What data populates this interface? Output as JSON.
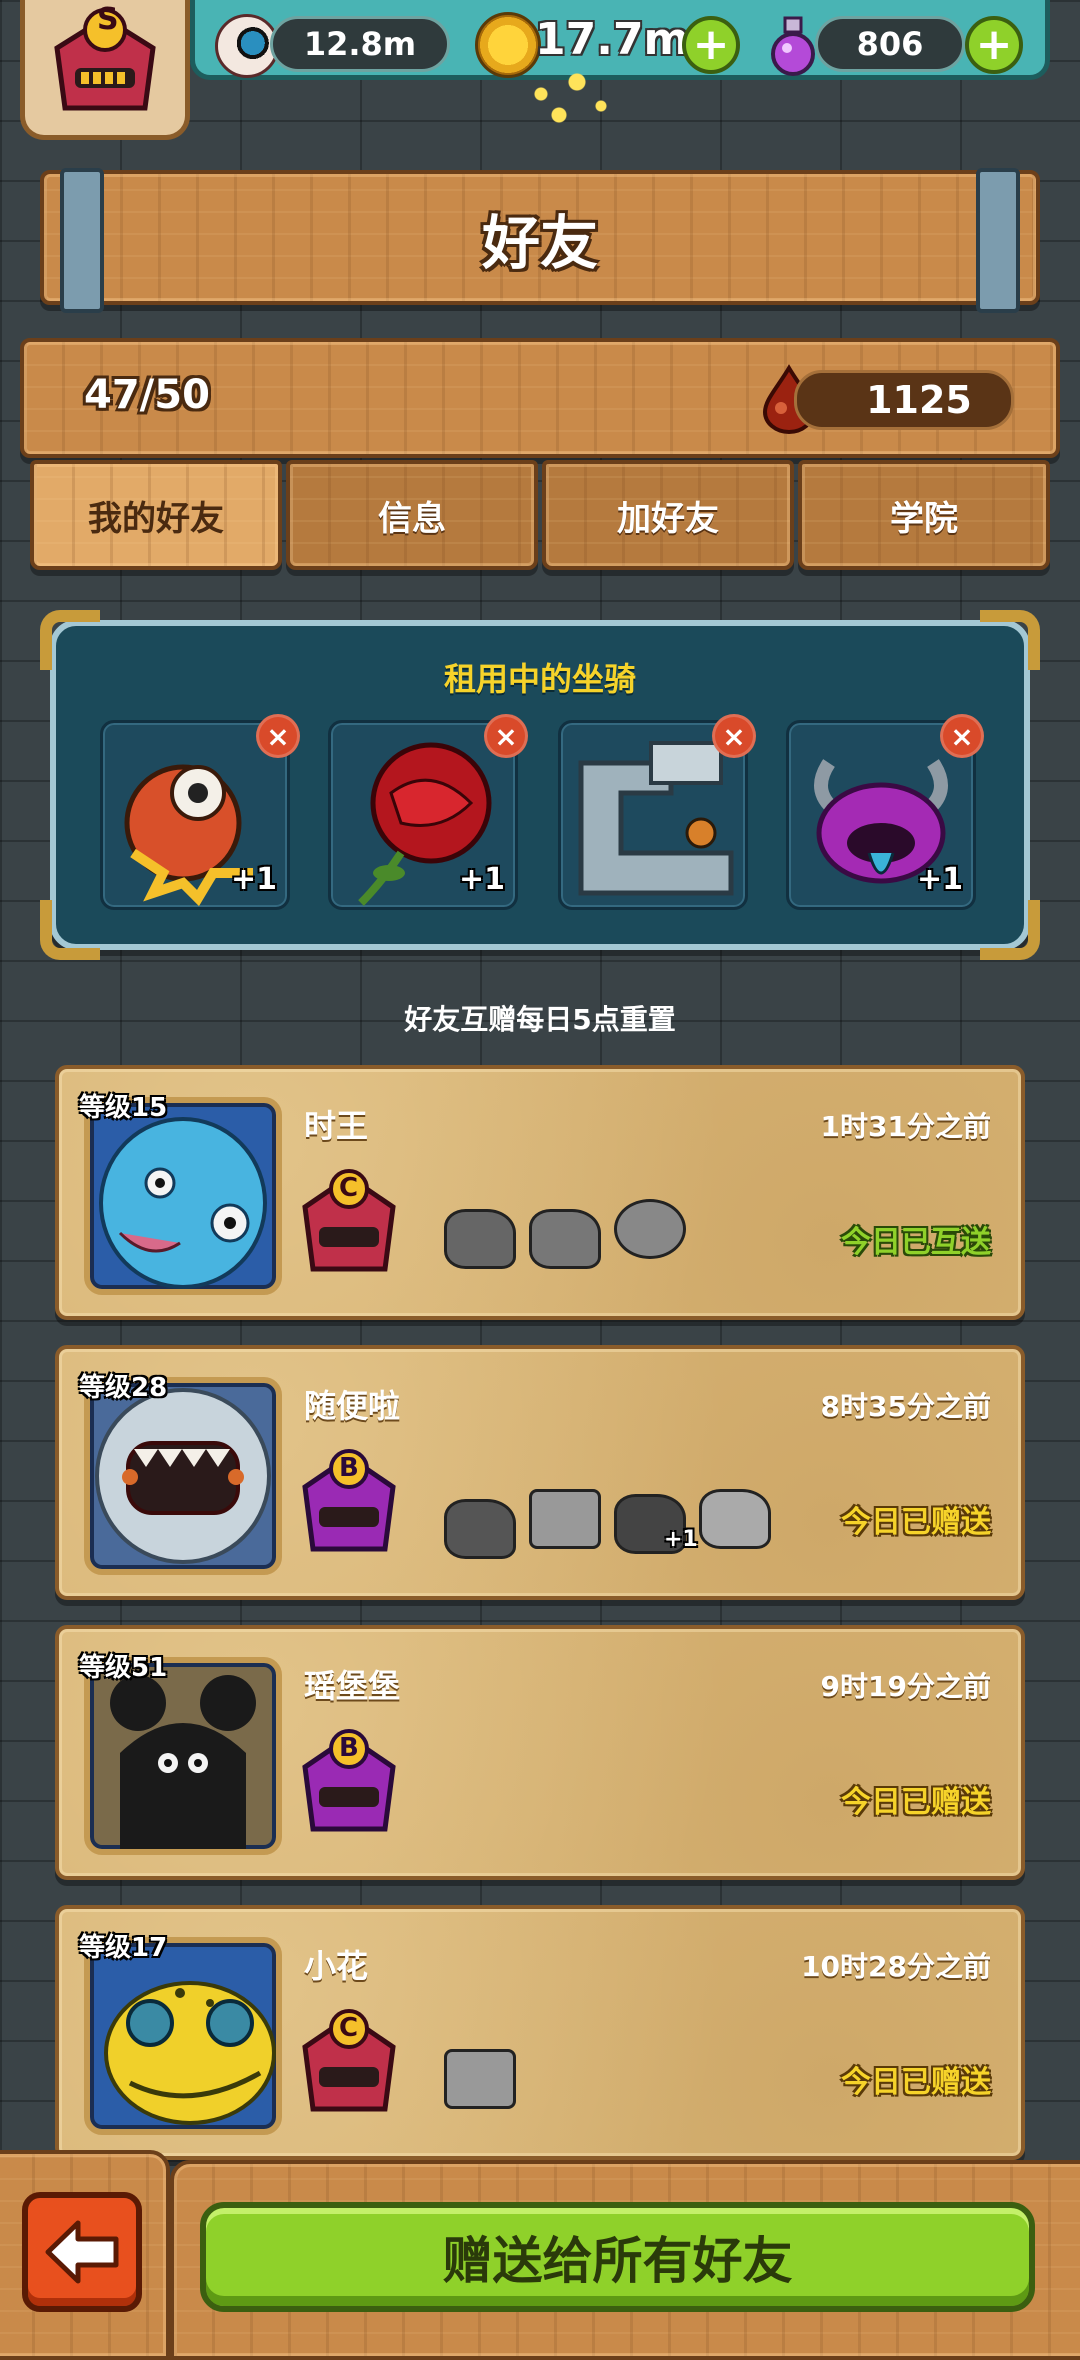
{
  "currency": {
    "eyes": "12.8m",
    "coins": "17.7m",
    "potions": "806"
  },
  "player_rank_letter": "S",
  "title": "好友",
  "friends_count": "47/50",
  "blood_drops": "1125",
  "tabs": [
    "我的好友",
    "信息",
    "加好友",
    "学院"
  ],
  "rented_mounts": {
    "title": "租用中的坐骑",
    "slots": [
      {
        "bonus": "+1",
        "icon": "lion-dance-mount-icon"
      },
      {
        "bonus": "+1",
        "icon": "rose-mount-icon"
      },
      {
        "bonus": "",
        "icon": "machine-mount-icon"
      },
      {
        "bonus": "+1",
        "icon": "purple-demon-mount-icon"
      }
    ]
  },
  "reset_note": "好友互赠每日5点重置",
  "friends": [
    {
      "level": "等级15",
      "name": "时王",
      "time": "1时31分之前",
      "rank": "C",
      "status": "今日已互送",
      "status_type": "mutual",
      "mounts": [
        "spiky-beast-icon",
        "drill-bot-icon",
        "pufferfish-icon"
      ]
    },
    {
      "level": "等级28",
      "name": "随便啦",
      "time": "8时35分之前",
      "rank": "B",
      "status": "今日已赠送",
      "status_type": "sent",
      "mounts": [
        "tank-icon",
        "robot-icon",
        "cat-mech-icon",
        "crane-beast-icon"
      ],
      "mount_bonus": "+1"
    },
    {
      "level": "等级51",
      "name": "瑶堡堡",
      "time": "9时19分之前",
      "rank": "B",
      "status": "今日已赠送",
      "status_type": "sent",
      "mounts": []
    },
    {
      "level": "等级17",
      "name": "小花",
      "time": "10时28分之前",
      "rank": "C",
      "status": "今日已赠送",
      "status_type": "sent",
      "mounts": [
        "robot-icon"
      ]
    }
  ],
  "gift_all_button": "赠送给所有好友",
  "colors": {
    "wood": "#c98a4a",
    "parchment": "#d8b474",
    "accent_green": "#8fd12a",
    "panel_teal": "#1e4a5e"
  }
}
